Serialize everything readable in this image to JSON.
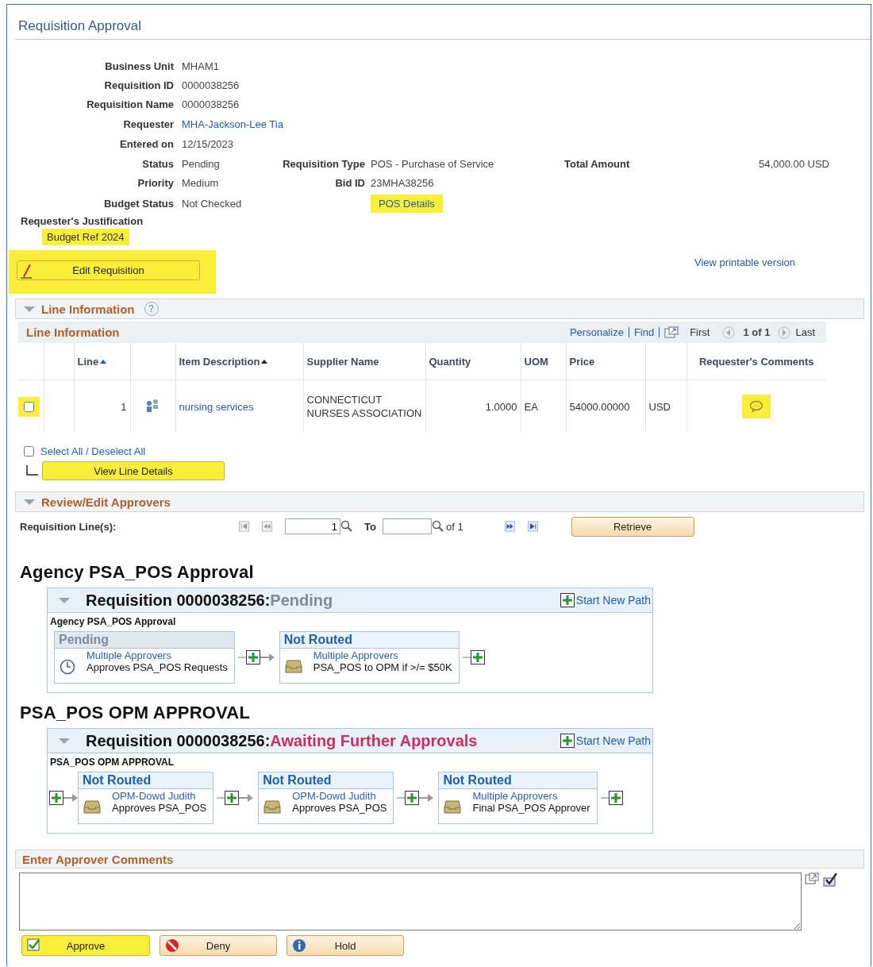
{
  "title": "Requisition Approval",
  "summary_rows": [
    {
      "fields": [
        {
          "label": "Business Unit",
          "value": "MHAM1",
          "kind": "text"
        }
      ]
    },
    {
      "fields": [
        {
          "label": "Requisition ID",
          "value": "0000038256",
          "kind": "text"
        }
      ]
    },
    {
      "fields": [
        {
          "label": "Requisition Name",
          "value": "0000038256",
          "kind": "text"
        }
      ]
    },
    {
      "fields": [
        {
          "label": "Requester",
          "value": "MHA-Jackson-Lee Tia",
          "kind": "link"
        }
      ]
    },
    {
      "fields": [
        {
          "label": "Entered on",
          "value": "12/15/2023",
          "kind": "text"
        }
      ]
    },
    {
      "fields": [
        {
          "label": "Status",
          "value": "Pending",
          "kind": "text"
        },
        {
          "label": "Requisition Type",
          "value": "POS - Purchase of Service",
          "kind": "text"
        },
        {
          "label": "Total Amount",
          "value": "54,000.00 USD",
          "kind": "text"
        }
      ]
    },
    {
      "fields": [
        {
          "label": "Priority",
          "value": "Medium",
          "kind": "text"
        },
        {
          "label": "Bid ID",
          "value": "23MHA38256",
          "kind": "text"
        }
      ]
    },
    {
      "fields": [
        {
          "label": "Budget Status",
          "value": "Not Checked",
          "kind": "text"
        },
        {
          "value": "POS Details",
          "kind": "link",
          "highlighted": true
        }
      ]
    }
  ],
  "justification": {
    "label": "Requester's Justification",
    "value": "Budget Ref 2024",
    "highlighted": true
  },
  "edit_button": {
    "label": "Edit Requisition",
    "highlighted": true
  },
  "printable_link": "View printable version",
  "line_section": {
    "title": "Line Information",
    "help": "?",
    "grid_title": "Line Information",
    "personalize": "Personalize",
    "find": "Find",
    "first": "First",
    "count": "1 of 1",
    "last": "Last",
    "columns": [
      {
        "label": "Line",
        "sorted": true
      },
      {
        "label": "Item Description",
        "sorted": true
      },
      {
        "label": "Supplier Name",
        "sorted": false
      },
      {
        "label": "Quantity",
        "sorted": false
      },
      {
        "label": "UOM",
        "sorted": false
      },
      {
        "label": "Price",
        "sorted": false
      },
      {
        "label": "Requester's Comments",
        "sorted": false
      }
    ],
    "rows": [
      {
        "checked": false,
        "check_highlighted": true,
        "line": "1",
        "item": "nursing services",
        "supplier": "CONNECTICUT NURSES ASSOCIATION",
        "quantity": "1.0000",
        "uom": "EA",
        "price": "54000.00000",
        "currency": "USD",
        "comment_highlighted": true
      }
    ],
    "select_all": {
      "label": "Select All / Deselect All",
      "checked": false
    },
    "view_button": {
      "label": "View Line Details",
      "highlighted": true
    }
  },
  "approvers_section": {
    "title": "Review/Edit Approvers",
    "lines_label": "Requisition Line(s):",
    "from": "1",
    "to_label": "To",
    "of": "of 1",
    "retrieve": "Retrieve"
  },
  "paths": [
    {
      "heading": "Agency PSA_POS Approval",
      "title": "Requisition 0000038256:",
      "status": "Pending",
      "color": "#7d8a9c",
      "start_new_path": "Start New Path",
      "subtitle": "Agency PSA_POS Approval",
      "leading_add": false,
      "steps": [
        {
          "status": "Pending",
          "kind": "pending",
          "approver": "Multiple Approvers",
          "description": "Approves PSA_POS Requests"
        },
        {
          "status": "Not Routed",
          "kind": "routed",
          "approver": "Multiple Approvers",
          "description": "PSA_POS to OPM if >/= $50K"
        }
      ]
    },
    {
      "heading": "PSA_POS OPM APPROVAL",
      "title": "Requisition 0000038256:",
      "status": "Awaiting Further Approvals",
      "color": "#c8305d",
      "start_new_path": "Start New Path",
      "subtitle": "PSA_POS OPM APPROVAL",
      "leading_add": true,
      "steps": [
        {
          "status": "Not Routed",
          "kind": "routed",
          "approver": "OPM-Dowd Judith",
          "description": "Approves PSA_POS"
        },
        {
          "status": "Not Routed",
          "kind": "routed",
          "approver": "OPM-Dowd Judith",
          "description": "Approves PSA_POS"
        },
        {
          "status": "Not Routed",
          "kind": "routed",
          "approver": "Multiple Approvers",
          "description": "Final PSA_POS Approver"
        }
      ]
    }
  ],
  "comments": {
    "title": "Enter Approver Comments"
  },
  "actions": [
    {
      "label": "Approve",
      "kind": "approve",
      "highlighted": true
    },
    {
      "label": "Deny",
      "kind": "deny",
      "highlighted": false
    },
    {
      "label": "Hold",
      "kind": "hold",
      "highlighted": false
    }
  ]
}
